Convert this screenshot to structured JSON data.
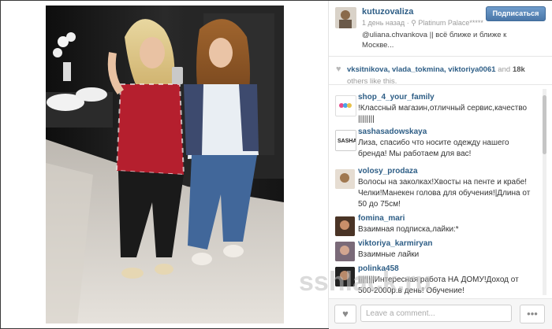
{
  "post": {
    "username": "kutuzovaliza",
    "time": "1 день назад",
    "location_icon": "pin-icon",
    "location": "Platinum Palace*****",
    "caption": "@uliana.chvankova || всё ближе и ближе к Москве..."
  },
  "follow_label": "Подписаться",
  "likes": {
    "users": "vksitnikova, vlada_tokmina, viktoriya0061",
    "and_word": "and",
    "count": "18k",
    "suffix": "others like this."
  },
  "comments": [
    {
      "user": "shop_4_your_family",
      "text": "!Классный магазин,отличный сервис,качество ||||||||"
    },
    {
      "user": "sashasadowskaya",
      "text": "Лиза, спасибо что носите одежду нашего бренда! Мы работаем для вас!"
    },
    {
      "user": "volosy_prodaza",
      "text": "Волосы на заколках!Хвосты на пенте и крабе! Челки!Манекен голова для обучения!|Длина от 50 до 75см!"
    },
    {
      "user": "fomina_mari",
      "text": "Взаимная подписка,лайки:*"
    },
    {
      "user": "viktoriya_karmiryan",
      "text": "Взаимные лайки"
    },
    {
      "user": "polinka458",
      "text": "||||||||Интересная работа НА ДОМУ!Доход от 500-2000р.в день! Обучение!"
    }
  ],
  "comment_placeholder": "Leave a comment...",
  "footer_heart_icon": "heart-icon",
  "footer_more_icon": "more-icon",
  "watermark": "sshlack.ru",
  "colors": {
    "link": "#2e5e86",
    "button": "#4a77a8",
    "muted": "#9b9b9b"
  }
}
